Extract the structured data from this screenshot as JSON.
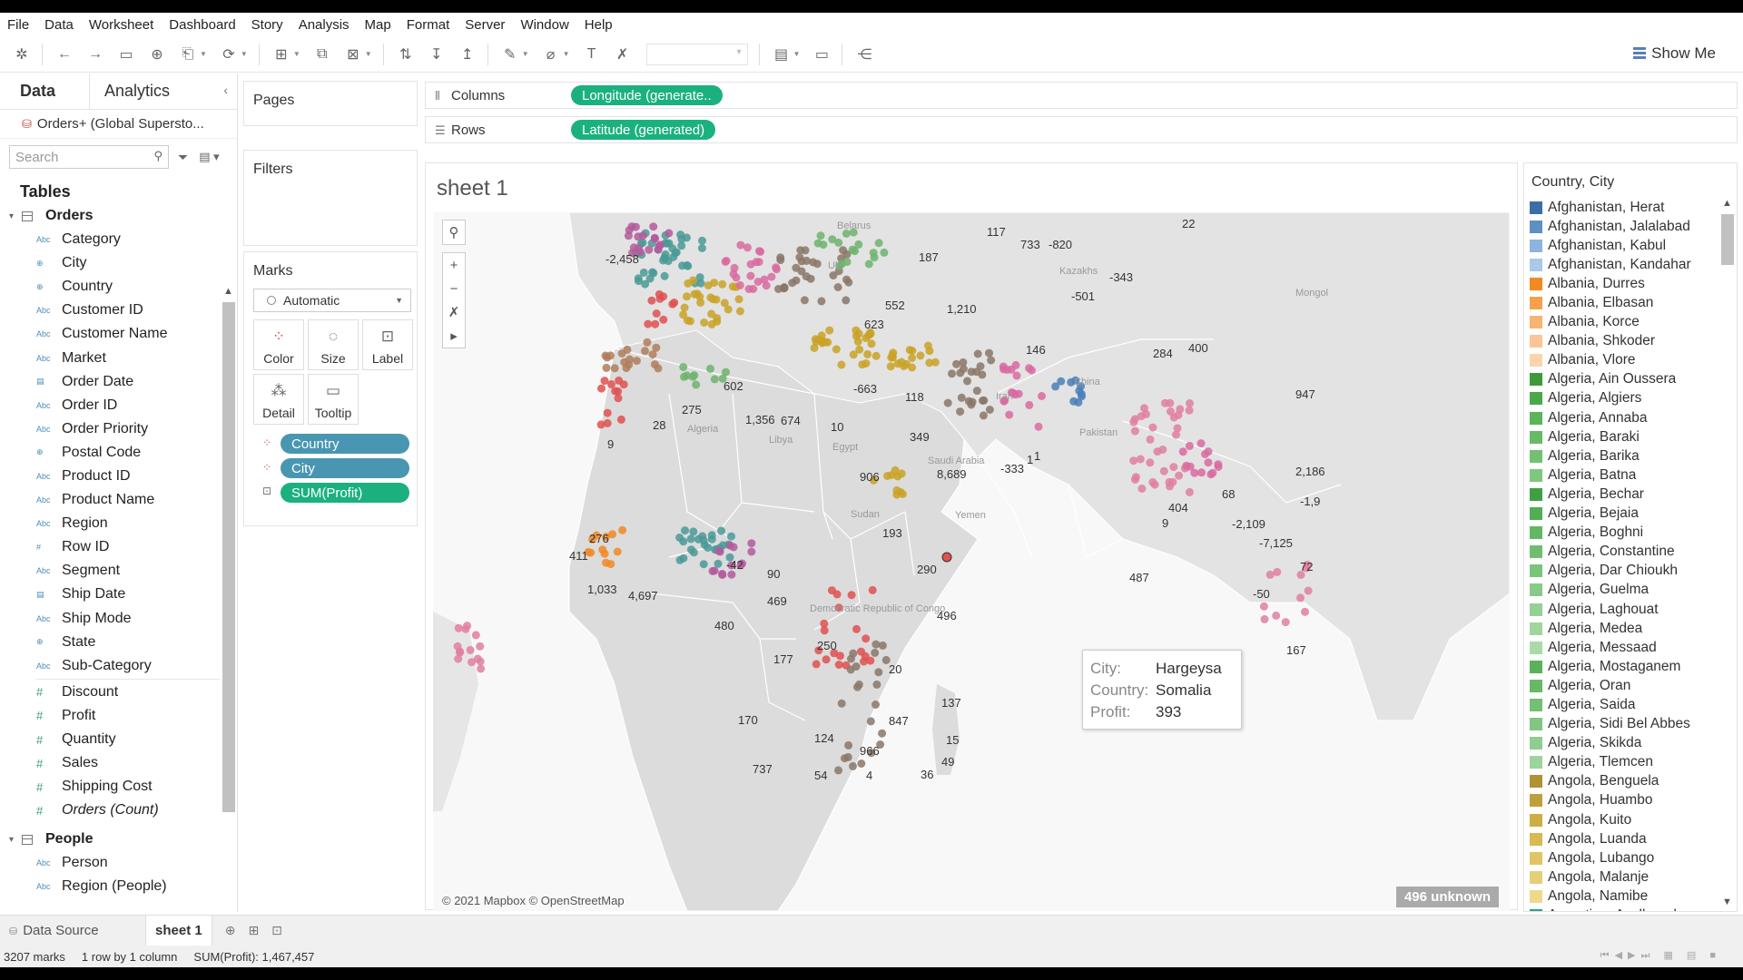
{
  "menu": [
    "File",
    "Data",
    "Worksheet",
    "Dashboard",
    "Story",
    "Analysis",
    "Map",
    "Format",
    "Server",
    "Window",
    "Help"
  ],
  "toolbar": {
    "show_me": "Show Me"
  },
  "data_pane": {
    "tab_data": "Data",
    "tab_analytics": "Analytics",
    "datasource": "Orders+ (Global Supersto...",
    "search_placeholder": "Search",
    "tables_heading": "Tables",
    "group_orders": "Orders",
    "dimensions": [
      {
        "type": "Abc",
        "name": "Category"
      },
      {
        "type": "geo",
        "name": "City"
      },
      {
        "type": "geo",
        "name": "Country"
      },
      {
        "type": "Abc",
        "name": "Customer ID"
      },
      {
        "type": "Abc",
        "name": "Customer Name"
      },
      {
        "type": "Abc",
        "name": "Market"
      },
      {
        "type": "date",
        "name": "Order Date"
      },
      {
        "type": "Abc",
        "name": "Order ID"
      },
      {
        "type": "Abc",
        "name": "Order Priority"
      },
      {
        "type": "geo",
        "name": "Postal Code"
      },
      {
        "type": "Abc",
        "name": "Product ID"
      },
      {
        "type": "Abc",
        "name": "Product Name"
      },
      {
        "type": "Abc",
        "name": "Region"
      },
      {
        "type": "#",
        "name": "Row ID"
      },
      {
        "type": "Abc",
        "name": "Segment"
      },
      {
        "type": "date",
        "name": "Ship Date"
      },
      {
        "type": "Abc",
        "name": "Ship Mode"
      },
      {
        "type": "geo",
        "name": "State"
      },
      {
        "type": "Abc",
        "name": "Sub-Category"
      }
    ],
    "measures": [
      "Discount",
      "Profit",
      "Quantity",
      "Sales",
      "Shipping Cost",
      "Orders (Count)"
    ],
    "group_people": "People",
    "people_fields": [
      "Person",
      "Region (People)"
    ]
  },
  "shelves": {
    "pages": "Pages",
    "filters": "Filters",
    "marks": "Marks",
    "marks_type": "Automatic",
    "mark_buttons": [
      "Color",
      "Size",
      "Label",
      "Detail",
      "Tooltip"
    ],
    "mark_pills": [
      "Country",
      "City",
      "SUM(Profit)"
    ],
    "columns_label": "Columns",
    "columns_pill": "Longitude (generate..",
    "rows_label": "Rows",
    "rows_pill": "Latitude (generated)"
  },
  "view": {
    "title": "sheet 1",
    "attribution": "© 2021 Mapbox © OpenStreetMap",
    "unknown": "496 unknown",
    "place_labels": [
      "Algeria",
      "Libya",
      "Egypt",
      "Sudan",
      "Yemen",
      "Saudi Arabia",
      "Iran",
      "Pakistan",
      "China",
      "Kazakhs",
      "Mongol",
      "Belarus",
      "Uk",
      "Democratic Republic of Congo"
    ],
    "profit_labels": [
      "-2,458",
      "552",
      "623",
      "1,210",
      "117",
      "733",
      "-820",
      "22",
      "187",
      "-343",
      "-501",
      "146",
      "284",
      "400",
      "602",
      "275",
      "28",
      "9",
      "1,356",
      "674",
      "10",
      "-663",
      "118",
      "349",
      "906",
      "8,689",
      "-333",
      "1",
      "947",
      "2,186",
      "193",
      "290",
      "496",
      "404",
      "9",
      "68",
      "-2,109",
      "-7,125",
      "-1,9",
      "72",
      "487",
      "-50",
      "167",
      "411",
      "276",
      "1,033",
      "4,697",
      "-42",
      "90",
      "469",
      "480",
      "250",
      "177",
      "20",
      "170",
      "124",
      "847",
      "966",
      "737",
      "54",
      "4",
      "137",
      "15",
      "49",
      "36",
      "1"
    ],
    "tooltip": [
      {
        "key": "City:",
        "value": "Hargeysa"
      },
      {
        "key": "Country:",
        "value": "Somalia"
      },
      {
        "key": "Profit:",
        "value": "393"
      }
    ]
  },
  "legend": {
    "title": "Country, City",
    "items": [
      {
        "label": "Afghanistan, Herat",
        "color": "#3b6ea8"
      },
      {
        "label": "Afghanistan, Jalalabad",
        "color": "#5f8fc3"
      },
      {
        "label": "Afghanistan, Kabul",
        "color": "#8cb4dc"
      },
      {
        "label": "Afghanistan, Kandahar",
        "color": "#a9c9e8"
      },
      {
        "label": "Albania, Durres",
        "color": "#f08a24"
      },
      {
        "label": "Albania, Elbasan",
        "color": "#f5a04d"
      },
      {
        "label": "Albania, Korce",
        "color": "#f7b472"
      },
      {
        "label": "Albania, Shkoder",
        "color": "#f9c594"
      },
      {
        "label": "Albania, Vlore",
        "color": "#fbd4ae"
      },
      {
        "label": "Algeria, Ain Oussera",
        "color": "#3c9a3c"
      },
      {
        "label": "Algeria, Algiers",
        "color": "#4aa84a"
      },
      {
        "label": "Algeria, Annaba",
        "color": "#5ab45a"
      },
      {
        "label": "Algeria, Baraki",
        "color": "#66bb66"
      },
      {
        "label": "Algeria, Barika",
        "color": "#72c172"
      },
      {
        "label": "Algeria, Batna",
        "color": "#7fc77f"
      },
      {
        "label": "Algeria, Bechar",
        "color": "#3fa043"
      },
      {
        "label": "Algeria, Bejaia",
        "color": "#52ae55"
      },
      {
        "label": "Algeria, Boghni",
        "color": "#62b764"
      },
      {
        "label": "Algeria, Constantine",
        "color": "#6fbe70"
      },
      {
        "label": "Algeria, Dar Chioukh",
        "color": "#7bc47c"
      },
      {
        "label": "Algeria, Guelma",
        "color": "#88ca88"
      },
      {
        "label": "Algeria, Laghouat",
        "color": "#95d094"
      },
      {
        "label": "Algeria, Medea",
        "color": "#a0d59f"
      },
      {
        "label": "Algeria, Messaad",
        "color": "#abdaa9"
      },
      {
        "label": "Algeria, Mostaganem",
        "color": "#5cb05c"
      },
      {
        "label": "Algeria, Oran",
        "color": "#68b868"
      },
      {
        "label": "Algeria, Saida",
        "color": "#75bf75"
      },
      {
        "label": "Algeria, Sidi Bel Abbes",
        "color": "#82c682"
      },
      {
        "label": "Algeria, Skikda",
        "color": "#90cd8f"
      },
      {
        "label": "Algeria, Tlemcen",
        "color": "#9dd39c"
      },
      {
        "label": "Angola, Benguela",
        "color": "#b09136"
      },
      {
        "label": "Angola, Huambo",
        "color": "#bf9f3c"
      },
      {
        "label": "Angola, Kuito",
        "color": "#cdad45"
      },
      {
        "label": "Angola, Luanda",
        "color": "#d8b954"
      },
      {
        "label": "Angola, Lubango",
        "color": "#e0c465"
      },
      {
        "label": "Angola, Malanje",
        "color": "#e7cf78"
      },
      {
        "label": "Angola, Namibe",
        "color": "#eed98c"
      },
      {
        "label": "Argentina, Avellaneda",
        "color": "#2e9e8f"
      }
    ]
  },
  "tabs": {
    "data_source": "Data Source",
    "sheet": "sheet 1"
  },
  "status": {
    "marks": "3207 marks",
    "layout": "1 row by 1 column",
    "sum": "SUM(Profit): 1,467,457"
  }
}
